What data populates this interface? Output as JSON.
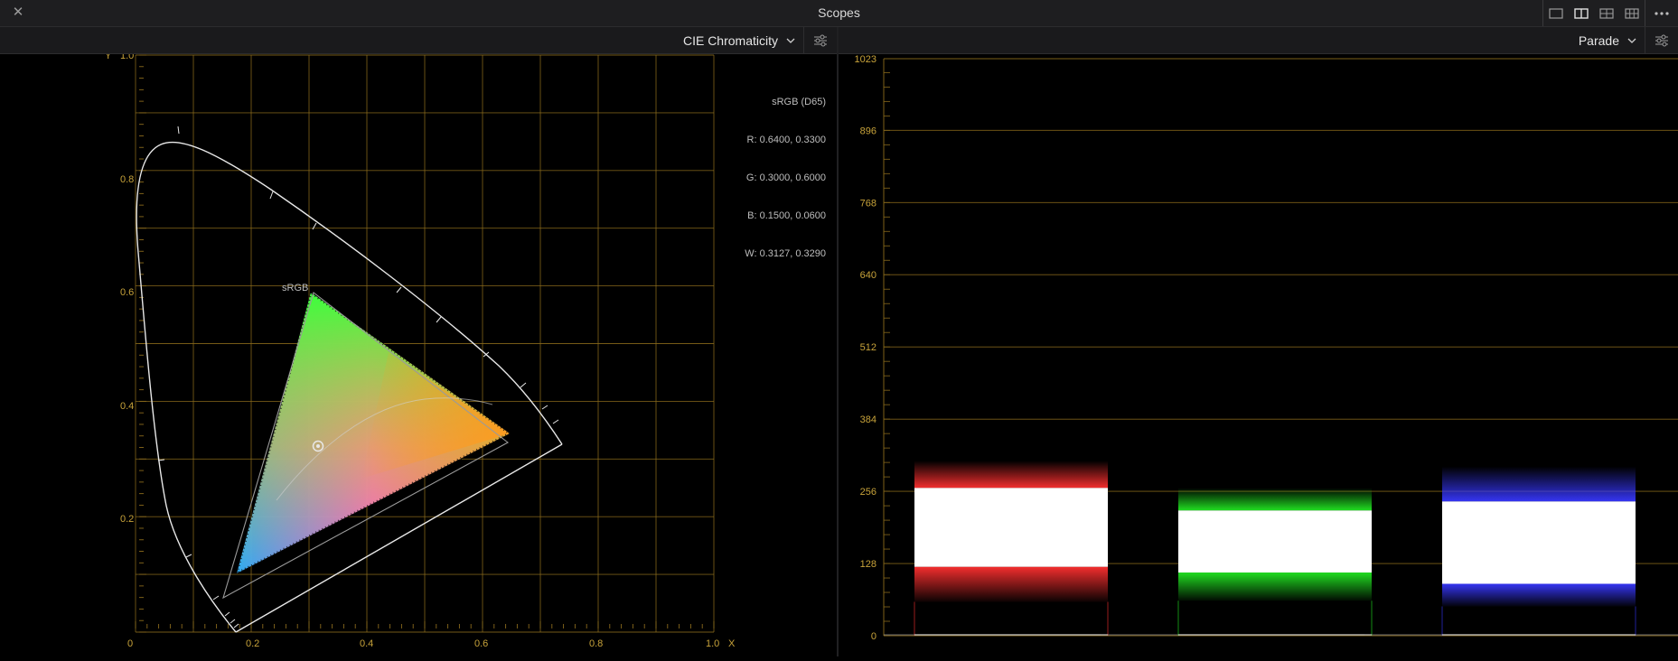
{
  "window": {
    "title": "Scopes",
    "close_glyph": "✕",
    "layout_buttons": [
      "single-view-icon",
      "dual-view-icon",
      "quad-view-icon",
      "grid-view-icon"
    ],
    "more_glyph": "more-dots-icon"
  },
  "left_scope": {
    "selected_scope": "CIE Chromaticity",
    "y_axis_letter": "Y",
    "x_axis_letter": "X",
    "y_ticks": [
      "1.0",
      "0.8",
      "0.6",
      "0.4",
      "0.2"
    ],
    "x_ticks": [
      "0",
      "0.2",
      "0.4",
      "0.6",
      "0.8",
      "1.0"
    ],
    "gamut_label": "sRGB",
    "info": {
      "colorspace": "sRGB (D65)",
      "red": "R: 0.6400, 0.3300",
      "green": "G: 0.3000, 0.6000",
      "blue": "B: 0.1500, 0.0600",
      "white": "W: 0.3127, 0.3290"
    },
    "gamut": {
      "red": [
        0.64,
        0.33
      ],
      "green": [
        0.3,
        0.6
      ],
      "blue": [
        0.15,
        0.06
      ],
      "white": [
        0.3127,
        0.329
      ]
    }
  },
  "right_scope": {
    "selected_scope": "Parade",
    "y_ticks": [
      "1023",
      "896",
      "768",
      "640",
      "512",
      "384",
      "256",
      "128",
      "0"
    ],
    "channels": [
      {
        "name": "red",
        "color": "#ff3030",
        "top_fringe": 310,
        "core_top": 262,
        "core_bottom": 122,
        "bottom_fringe": 60
      },
      {
        "name": "green",
        "color": "#22e822",
        "top_fringe": 262,
        "core_top": 222,
        "core_bottom": 112,
        "bottom_fringe": 62
      },
      {
        "name": "blue",
        "color": "#3838ff",
        "top_fringe": 300,
        "core_top": 238,
        "core_bottom": 92,
        "bottom_fringe": 52
      }
    ]
  },
  "colors": {
    "grid": "#8a6a1c",
    "tick_label": "#c8a33a",
    "locus": "#e8e8e8"
  }
}
